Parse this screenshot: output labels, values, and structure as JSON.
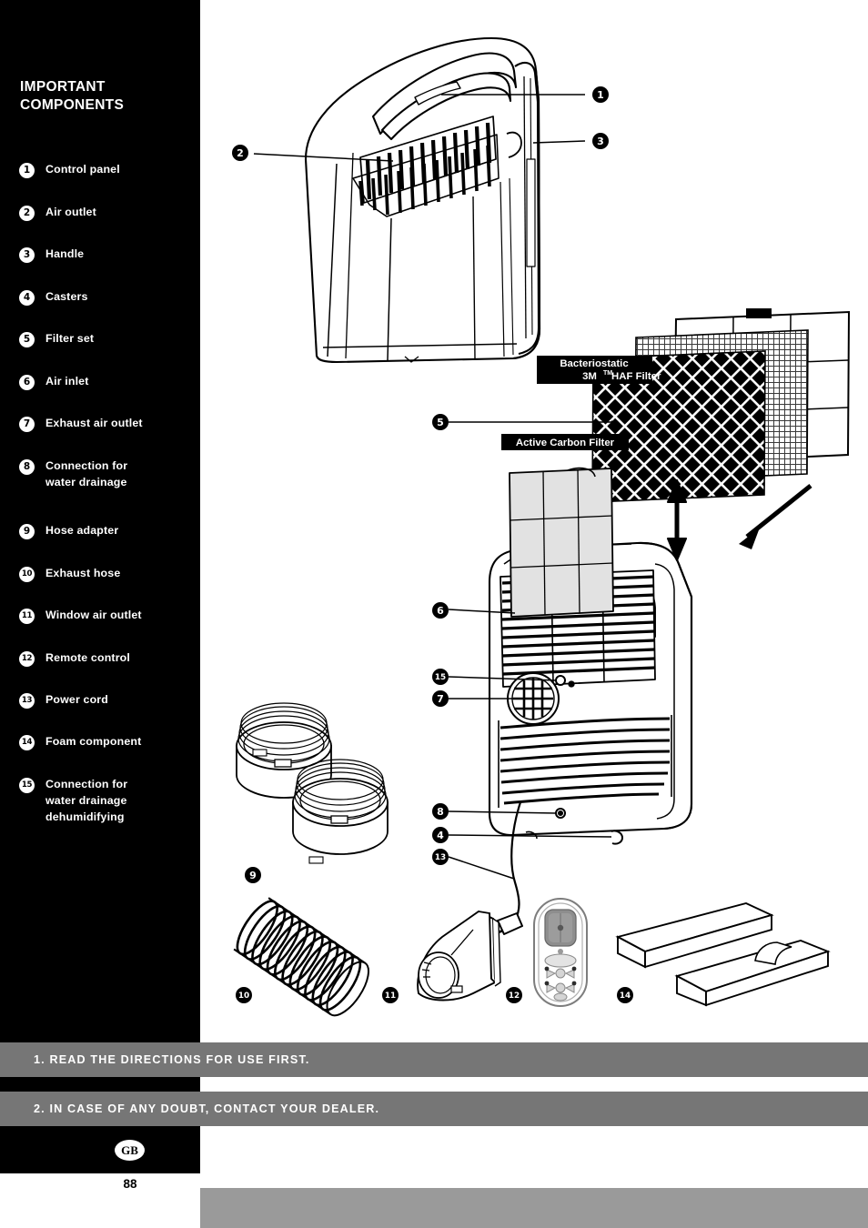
{
  "sidebar": {
    "title_line1": "IMPORTANT",
    "title_line2": "COMPONENTS",
    "items": [
      {
        "num": "1",
        "label": "Control panel"
      },
      {
        "num": "2",
        "label": "Air outlet"
      },
      {
        "num": "3",
        "label": "Handle"
      },
      {
        "num": "4",
        "label": "Casters"
      },
      {
        "num": "5",
        "label": "Filter set"
      },
      {
        "num": "6",
        "label": "Air inlet"
      },
      {
        "num": "7",
        "label": "Exhaust air outlet"
      },
      {
        "num": "8",
        "label": "Connection for\nwater drainage"
      },
      {
        "num": "9",
        "label": "Hose adapter"
      },
      {
        "num": "10",
        "label": "Exhaust hose"
      },
      {
        "num": "11",
        "label": "Window air outlet"
      },
      {
        "num": "12",
        "label": "Remote control"
      },
      {
        "num": "13",
        "label": "Power cord"
      },
      {
        "num": "14",
        "label": "Foam component"
      },
      {
        "num": "15",
        "label": "Connection for\nwater drainage\ndehumidifying"
      }
    ]
  },
  "diagram": {
    "callouts": [
      "1",
      "2",
      "3",
      "4",
      "5",
      "6",
      "7",
      "8",
      "9",
      "10",
      "11",
      "12",
      "13",
      "14",
      "15"
    ],
    "labels": {
      "filter_top_line1": "Bacteriostatic",
      "filter_top_line2_a": "3M",
      "filter_top_line2_tm": "TM",
      "filter_top_line2_b": " HAF Filter",
      "filter_bottom": "Active Carbon Filter"
    }
  },
  "banners": {
    "banner1": "1. READ THE DIRECTIONS FOR USE FIRST.",
    "banner2": "2. IN CASE OF ANY DOUBT, CONTACT YOUR DEALER."
  },
  "footer": {
    "language_code": "GB",
    "page_number": "88"
  },
  "colors": {
    "sidebar_bg": "#000000",
    "banner_bg": "#767676",
    "footer_strip_bg": "#9a9a9a",
    "text_light": "#ffffff",
    "line": "#000000"
  }
}
